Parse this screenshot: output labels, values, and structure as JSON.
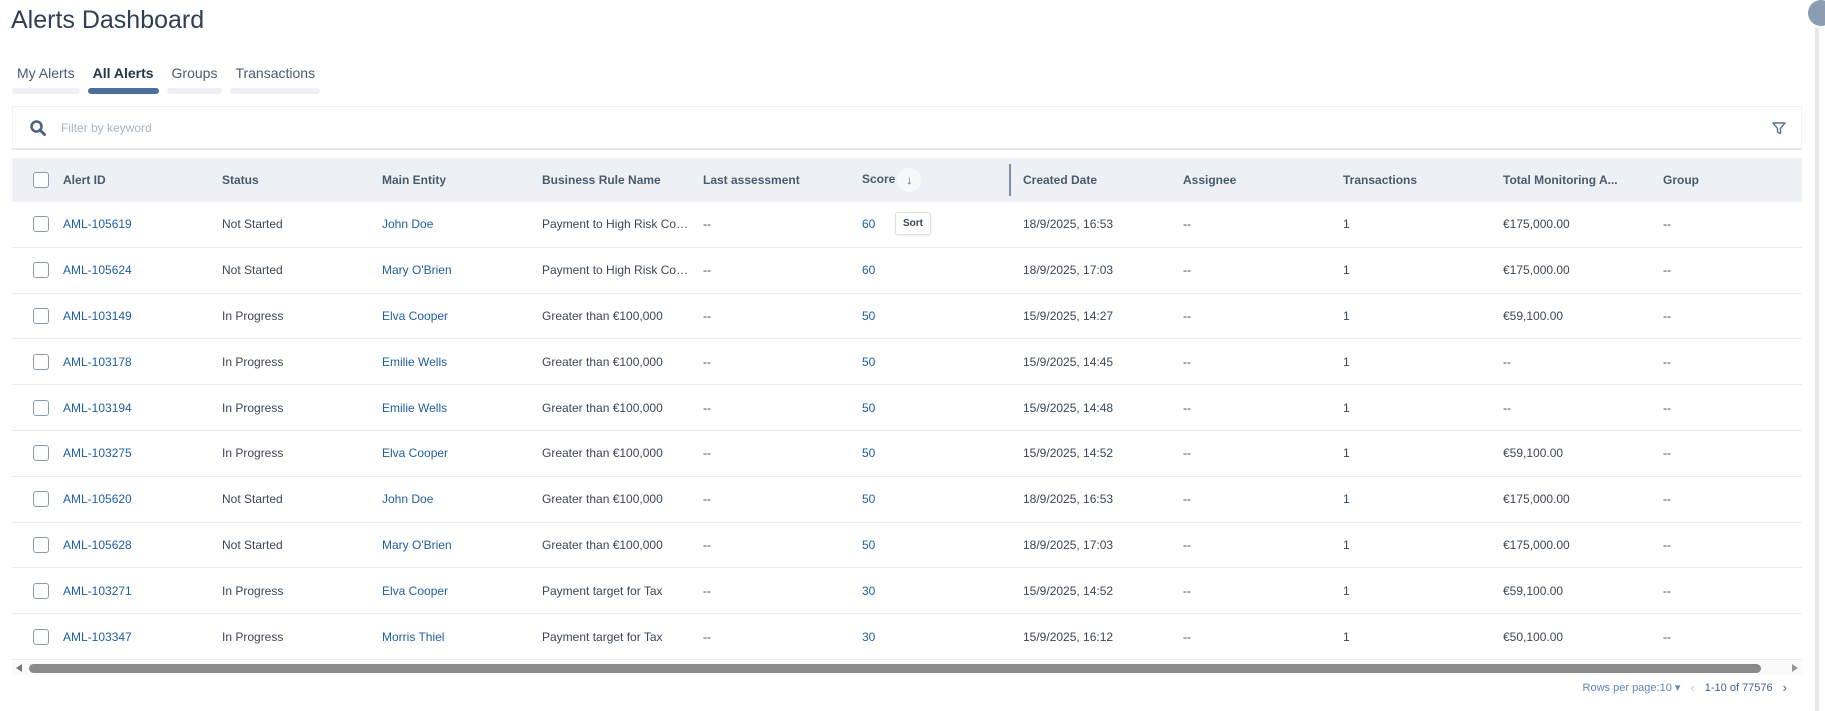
{
  "page": {
    "title": "Alerts Dashboard"
  },
  "tabs": [
    {
      "label": "My Alerts"
    },
    {
      "label": "All Alerts",
      "active": true
    },
    {
      "label": "Groups"
    },
    {
      "label": "Transactions"
    }
  ],
  "search": {
    "placeholder": "Filter by keyword"
  },
  "columns": [
    "Alert ID",
    "Status",
    "Main Entity",
    "Business Rule Name",
    "Last assessment",
    "Score",
    "Created Date",
    "Assignee",
    "Transactions",
    "Total Monitoring A...",
    "Group"
  ],
  "sort_tooltip": "Sort",
  "rows": [
    [
      "AML-105619",
      "Not Started",
      "John Doe",
      "Payment to High Risk Cou...",
      "--",
      "60",
      "18/9/2025, 16:53",
      "--",
      "1",
      "€175,000.00",
      "--"
    ],
    [
      "AML-105624",
      "Not Started",
      "Mary O'Brien",
      "Payment to High Risk Cou...",
      "--",
      "60",
      "18/9/2025, 17:03",
      "--",
      "1",
      "€175,000.00",
      "--"
    ],
    [
      "AML-103149",
      "In Progress",
      "Elva Cooper",
      "Greater than €100,000",
      "--",
      "50",
      "15/9/2025, 14:27",
      "--",
      "1",
      "€59,100.00",
      "--"
    ],
    [
      "AML-103178",
      "In Progress",
      "Emilie Wells",
      "Greater than €100,000",
      "--",
      "50",
      "15/9/2025, 14:45",
      "--",
      "1",
      "--",
      "--"
    ],
    [
      "AML-103194",
      "In Progress",
      "Emilie Wells",
      "Greater than €100,000",
      "--",
      "50",
      "15/9/2025, 14:48",
      "--",
      "1",
      "--",
      "--"
    ],
    [
      "AML-103275",
      "In Progress",
      "Elva Cooper",
      "Greater than €100,000",
      "--",
      "50",
      "15/9/2025, 14:52",
      "--",
      "1",
      "€59,100.00",
      "--"
    ],
    [
      "AML-105620",
      "Not Started",
      "John Doe",
      "Greater than €100,000",
      "--",
      "50",
      "18/9/2025, 16:53",
      "--",
      "1",
      "€175,000.00",
      "--"
    ],
    [
      "AML-105628",
      "Not Started",
      "Mary O'Brien",
      "Greater than €100,000",
      "--",
      "50",
      "18/9/2025, 17:03",
      "--",
      "1",
      "€175,000.00",
      "--"
    ],
    [
      "AML-103271",
      "In Progress",
      "Elva Cooper",
      "Payment target for Tax",
      "--",
      "30",
      "15/9/2025, 14:52",
      "--",
      "1",
      "€59,100.00",
      "--"
    ],
    [
      "AML-103347",
      "In Progress",
      "Morris Thiel",
      "Payment target for Tax",
      "--",
      "30",
      "15/9/2025, 16:12",
      "--",
      "1",
      "€50,100.00",
      "--"
    ]
  ],
  "pagination": {
    "rows_per_page": "Rows per page:10",
    "range": "1-10 of 77576"
  }
}
